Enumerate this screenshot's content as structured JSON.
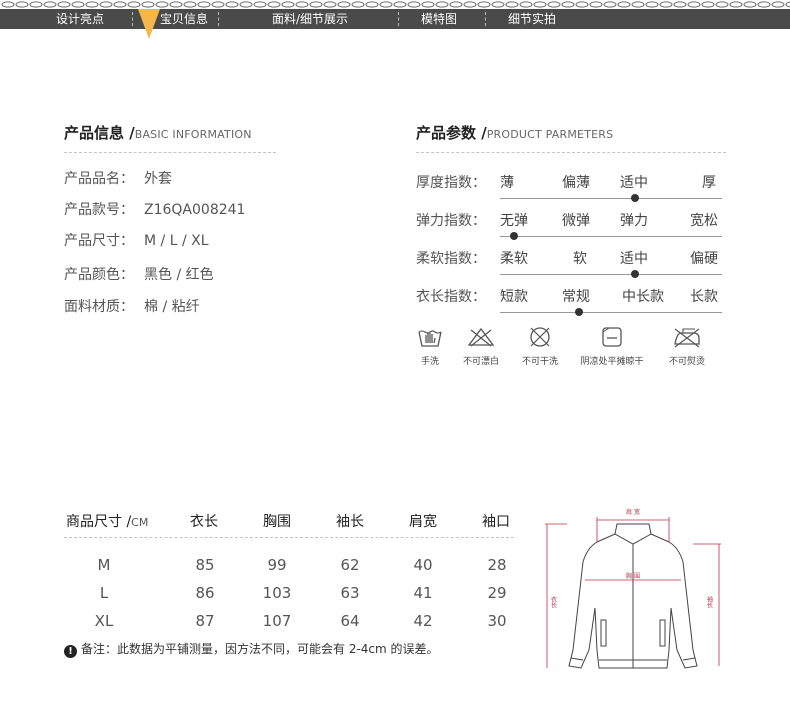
{
  "nav": {
    "items": [
      "设计亮点",
      "宝贝信息",
      "面料/细节展示",
      "模特图",
      "细节实拍"
    ],
    "active_index": 1,
    "bar_color": "#4a4a4a",
    "accent_color": "#f3b74a"
  },
  "product_info": {
    "title_cn": "产品信息 /",
    "title_en": "BASIC INFORMATION",
    "rows": [
      {
        "label": "产品品名：",
        "value": "外套"
      },
      {
        "label": "产品款号：",
        "value": "Z16QA008241"
      },
      {
        "label": "产品尺寸：",
        "value": "M / L / XL"
      },
      {
        "label": "产品颜色：",
        "value": "黑色 / 红色"
      },
      {
        "label": "面料材质：",
        "value": "棉 / 粘纤"
      }
    ]
  },
  "product_params": {
    "title_cn": "产品参数 /",
    "title_en": "PRODUCT PARMETERS",
    "rows": [
      {
        "label": "厚度指数：",
        "options": [
          "薄",
          "偏薄",
          "适中",
          "厚"
        ],
        "selected": 2
      },
      {
        "label": "弹力指数：",
        "options": [
          "无弹",
          "微弹",
          "弹力",
          "宽松"
        ],
        "selected": 0
      },
      {
        "label": "柔软指数：",
        "options": [
          "柔软",
          "软",
          "适中",
          "偏硬"
        ],
        "selected": 2
      },
      {
        "label": "衣长指数：",
        "options": [
          "短款",
          "常规",
          "中长款",
          "长款"
        ],
        "selected": 1
      }
    ]
  },
  "care": [
    {
      "icon": "hand-wash-icon",
      "label": "手洗"
    },
    {
      "icon": "no-bleach-icon",
      "label": "不可漂白"
    },
    {
      "icon": "no-dry-clean-icon",
      "label": "不可干洗"
    },
    {
      "icon": "shade-flat-dry-icon",
      "label": "阴凉处平摊晾干"
    },
    {
      "icon": "no-iron-icon",
      "label": "不可熨烫"
    }
  ],
  "size_table": {
    "header_cn": "商品尺寸 /",
    "header_unit": "CM",
    "columns": [
      "衣长",
      "胸围",
      "袖长",
      "肩宽",
      "袖口"
    ],
    "rows": [
      {
        "size": "M",
        "values": [
          "85",
          "99",
          "62",
          "40",
          "28"
        ]
      },
      {
        "size": "L",
        "values": [
          "86",
          "103",
          "63",
          "41",
          "29"
        ]
      },
      {
        "size": "XL",
        "values": [
          "87",
          "107",
          "64",
          "42",
          "30"
        ]
      }
    ]
  },
  "note": {
    "mark": "!",
    "text": "备注：此数据为平铺测量，因方法不同，可能会有 2-4cm 的误差。"
  },
  "diagram": {
    "shoulder": "肩 宽",
    "chest": "胸 围",
    "length": "衣长",
    "sleeve": "袖长",
    "measure_color": "#c0304a"
  }
}
